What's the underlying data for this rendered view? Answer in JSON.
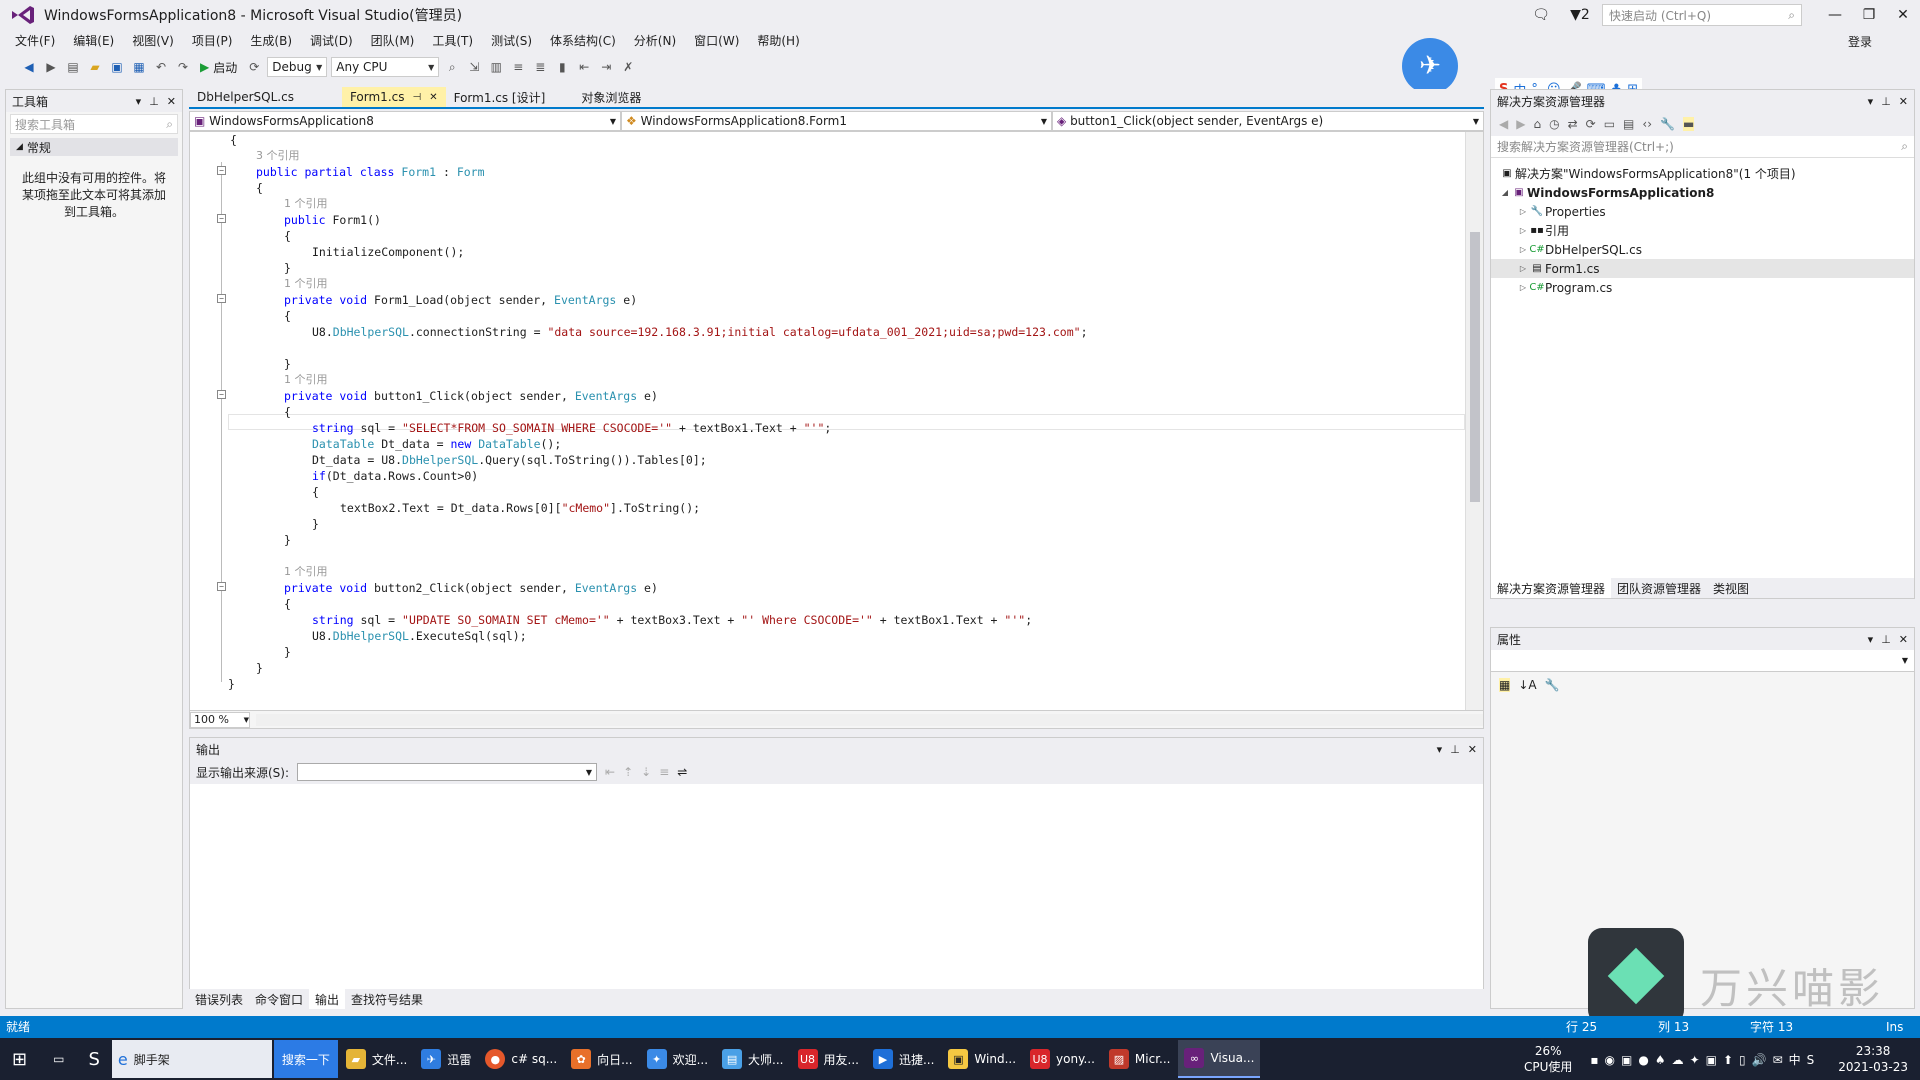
{
  "window": {
    "title": "WindowsFormsApplication8 - Microsoft Visual Studio(管理员)",
    "notif_count": "2",
    "quick_launch_placeholder": "快速启动 (Ctrl+Q)",
    "login": "登录"
  },
  "menu": [
    "文件(F)",
    "编辑(E)",
    "视图(V)",
    "项目(P)",
    "生成(B)",
    "调试(D)",
    "团队(M)",
    "工具(T)",
    "测试(S)",
    "体系结构(C)",
    "分析(N)",
    "窗口(W)",
    "帮助(H)"
  ],
  "toolbar": {
    "start_label": "启动",
    "config": "Debug",
    "platform": "Any CPU"
  },
  "toolbox": {
    "title": "工具箱",
    "search_placeholder": "搜索工具箱",
    "group": "常规",
    "empty_text": "此组中没有可用的控件。将某项拖至此文本可将其添加到工具箱。"
  },
  "doc_tabs": [
    {
      "label": "DbHelperSQL.cs"
    },
    {
      "label": "Form1.cs"
    },
    {
      "label": "Form1.cs [设计]"
    },
    {
      "label": "对象浏览器"
    }
  ],
  "navbar": {
    "project": "WindowsFormsApplication8",
    "class": "WindowsFormsApplication8.Form1",
    "member": "button1_Click(object sender, EventArgs e)"
  },
  "code": {
    "refs3": "3 个引用",
    "ref1": "1 个引用",
    "open_brace": "{",
    "close_brace": "}",
    "l_class_kw1": "public partial class ",
    "l_class_name": "Form1",
    "l_class_sep": " : ",
    "l_class_base": "Form",
    "l_ctor_kw": "public ",
    "l_ctor_rest": "Form1()",
    "l_init": "InitializeComponent();",
    "l_load_kw": "private void ",
    "l_load_mid": "Form1_Load(object sender, ",
    "l_evargs": "EventArgs",
    "l_e": " e)",
    "l_conn_pre": "U8.",
    "l_conn_ty": "DbHelperSQL",
    "l_conn_mid": ".connectionString = ",
    "l_conn_str": "\"data source=192.168.3.91;initial catalog=ufdata_001_2021;uid=sa;pwd=123.com\"",
    "l_semi": ";",
    "l_b1_mid": "button1_Click(object sender, ",
    "l_sql1_kw": "string",
    "l_sql1_mid": " sql = ",
    "l_sql1_str": "\"SELECT*FROM SO_SOMAIN WHERE CSOCODE='\"",
    "l_sql1_plus": " + textBox1.Text + ",
    "l_sql1_end": "\"'\"",
    "l_dt_ty": "DataTable",
    "l_dt_mid": " Dt_data = ",
    "l_new": "new ",
    "l_dt_tail": "();",
    "l_q_pre": "Dt_data = U8.",
    "l_q_rest": ".Query(sql.ToString()).Tables[0];",
    "l_if_kw": "if",
    "l_if_rest": "(Dt_data.Rows.Count>0)",
    "l_tb2_pre": "textBox2.Text = Dt_data.Rows[0][",
    "l_tb2_str": "\"cMemo\"",
    "l_tb2_rest": "].ToString();",
    "l_b2_mid": "button2_Click(object sender, ",
    "l_sql2_str1": "\"UPDATE SO_SOMAIN SET cMemo='\"",
    "l_sql2_plus1": " + textBox3.Text + ",
    "l_sql2_str2": "\"' Where CSOCODE='\"",
    "l_sql2_plus2": " + textBox1.Text + ",
    "l_exec_rest": ".ExecuteSql(sql);"
  },
  "zoom": "100 %",
  "output": {
    "title": "输出",
    "source_label": "显示输出来源(S):"
  },
  "bottom_tabs": [
    "错误列表",
    "命令窗口",
    "输出",
    "查找符号结果"
  ],
  "solution": {
    "title": "解决方案资源管理器",
    "search_placeholder": "搜索解决方案资源管理器(Ctrl+;)",
    "root": "解决方案\"WindowsFormsApplication8\"(1 个项目)",
    "project": "WindowsFormsApplication8",
    "items": [
      "Properties",
      "引用",
      "DbHelperSQL.cs",
      "Form1.cs",
      "Program.cs"
    ],
    "tabs": [
      "解决方案资源管理器",
      "团队资源管理器",
      "类视图"
    ]
  },
  "properties": {
    "title": "属性"
  },
  "status": {
    "ready": "就绪",
    "row": "行 25",
    "col": "列 13",
    "char": "字符 13",
    "ins": "Ins"
  },
  "taskbar": {
    "search_text": "脚手架",
    "search_btn": "搜索一下",
    "apps": [
      "文件...",
      "迅雷",
      "c# sq...",
      "向日...",
      "欢迎...",
      "大师...",
      "用友...",
      "迅捷...",
      "Wind...",
      "yony...",
      "Micr...",
      "Visua..."
    ],
    "cpu": "26%",
    "cpu_label": "CPU使用",
    "time": "23:38",
    "date": "2021-03-23"
  },
  "watermark_text": "万兴喵影",
  "colors": {
    "accent": "#007acc",
    "keyword": "#0000ff",
    "type": "#2b91af",
    "string": "#a31515",
    "active_tab": "#fff1a8"
  }
}
